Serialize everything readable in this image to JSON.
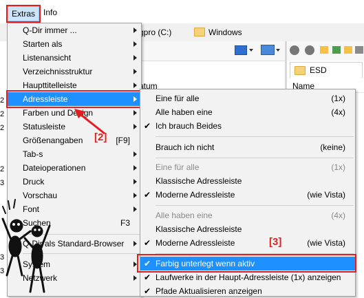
{
  "menubar": {
    "extras": "Extras",
    "info": "Info"
  },
  "background": {
    "drive_label": "ɡpro (C:)",
    "folder_label": "Windows",
    "tab_label": "ESD",
    "column_name": "Name",
    "column_datum": "atum",
    "left_strip": [
      "2",
      "2",
      "2",
      "2",
      "3",
      "3",
      "3"
    ]
  },
  "extras_menu": [
    {
      "label": "Q-Dir immer ...",
      "submenu": true
    },
    {
      "label": "Starten als",
      "submenu": true
    },
    {
      "label": "Listenansicht",
      "submenu": true
    },
    {
      "label": "Verzeichnisstruktur",
      "submenu": true
    },
    {
      "label": "Haupttitelleiste",
      "submenu": true
    },
    {
      "label": "Adressleiste",
      "submenu": true,
      "highlighted": true
    },
    {
      "label": "Farben und Design",
      "submenu": true
    },
    {
      "label": "Statusleiste",
      "submenu": true
    },
    {
      "label": "Größenangaben",
      "shortcut": "[F9]"
    },
    {
      "label": "Tab-s",
      "submenu": true
    },
    {
      "label": "Dateioperationen",
      "submenu": true
    },
    {
      "label": "Druck",
      "submenu": true
    },
    {
      "label": "Vorschau",
      "submenu": true
    },
    {
      "label": "Font",
      "submenu": true
    },
    {
      "label": "Suchen",
      "shortcut": "F3"
    },
    {
      "label": "Q-Dir als Standard-Browser",
      "submenu": true
    },
    {
      "label": "System",
      "submenu": true
    },
    {
      "label": "Netzwerk",
      "submenu": true
    }
  ],
  "adress_submenu": {
    "group1": [
      {
        "label": "Eine für alle",
        "shortcut": "(1x)"
      },
      {
        "label": "Alle haben eine",
        "shortcut": "(4x)"
      },
      {
        "label": "Ich brauch Beides",
        "checked": true
      }
    ],
    "group2": [
      {
        "label": "Brauch ich nicht",
        "shortcut": "(keine)"
      }
    ],
    "group3": [
      {
        "label": "Eine für alle",
        "shortcut": "(1x)",
        "disabled": true
      },
      {
        "label": "Klassische Adressleiste"
      },
      {
        "label": "Moderne Adressleiste",
        "shortcut": "(wie Vista)",
        "checked": true
      }
    ],
    "group4": [
      {
        "label": "Alle haben eine",
        "shortcut": "(4x)",
        "disabled": true
      },
      {
        "label": "Klassische Adressleiste"
      },
      {
        "label": "Moderne Adressleiste",
        "shortcut": "(wie Vista)",
        "checked": true
      }
    ],
    "group5": [
      {
        "label": "Farbig unterlegt wenn aktiv",
        "checked": true,
        "highlighted": true
      },
      {
        "label": "Laufwerke in der Haupt-Adressleiste (1x) anzeigen",
        "checked": true
      },
      {
        "label": "Pfade Aktualisieren anzeigen",
        "checked": true
      }
    ]
  },
  "annotations": {
    "marker2": "[2]",
    "marker3": "[3]"
  },
  "colors": {
    "highlight": "#1e90ff",
    "annotation_red": "#e41e1e",
    "menu_bg": "#f2f2f2"
  }
}
